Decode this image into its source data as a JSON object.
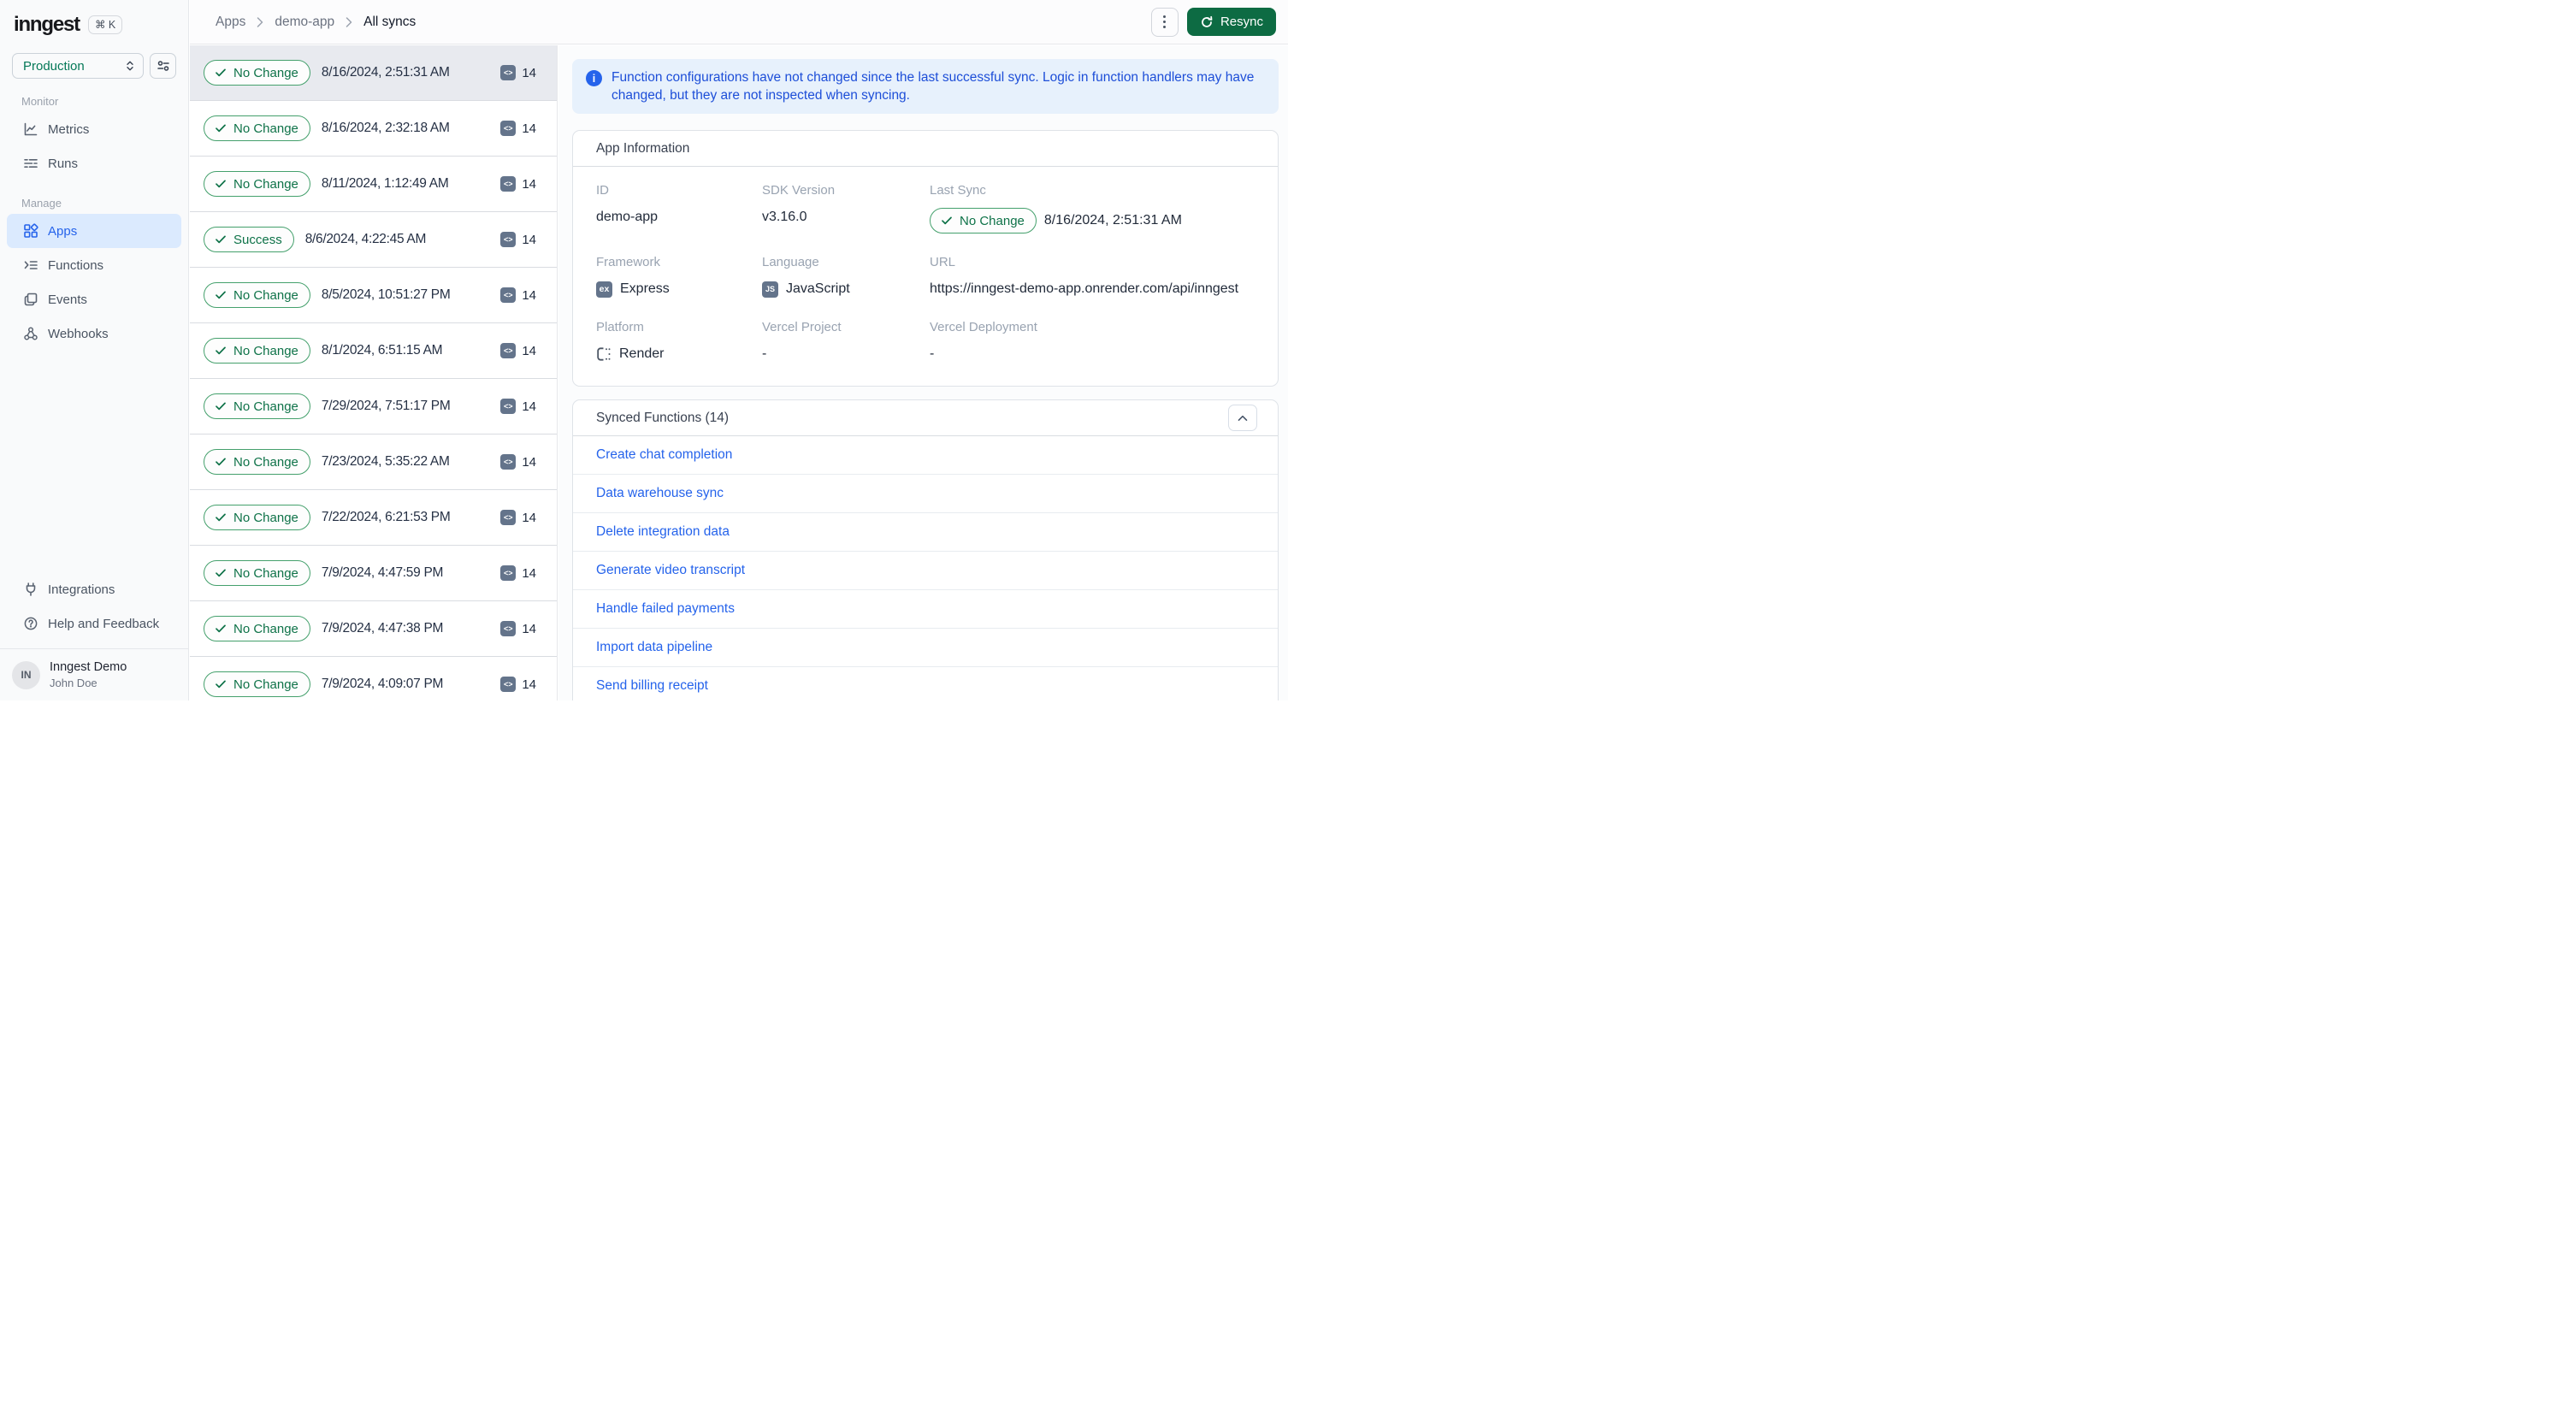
{
  "sidebar": {
    "logo": "inngest",
    "search_shortcut": "⌘ K",
    "environment": "Production",
    "sections": [
      {
        "label": "Monitor",
        "items": [
          "Metrics",
          "Runs"
        ]
      },
      {
        "label": "Manage",
        "items": [
          "Apps",
          "Functions",
          "Events",
          "Webhooks"
        ]
      }
    ],
    "footer_items": [
      "Integrations",
      "Help and Feedback"
    ],
    "profile": {
      "initials": "IN",
      "org": "Inngest Demo",
      "user": "John Doe"
    }
  },
  "header": {
    "breadcrumb": [
      "Apps",
      "demo-app",
      "All syncs"
    ],
    "resync": "Resync"
  },
  "sync_list": [
    {
      "status": "No Change",
      "timestamp": "8/16/2024, 2:51:31 AM",
      "count": 14,
      "selected": true
    },
    {
      "status": "No Change",
      "timestamp": "8/16/2024, 2:32:18 AM",
      "count": 14
    },
    {
      "status": "No Change",
      "timestamp": "8/11/2024, 1:12:49 AM",
      "count": 14
    },
    {
      "status": "Success",
      "timestamp": "8/6/2024, 4:22:45 AM",
      "count": 14
    },
    {
      "status": "No Change",
      "timestamp": "8/5/2024, 10:51:27 PM",
      "count": 14
    },
    {
      "status": "No Change",
      "timestamp": "8/1/2024, 6:51:15 AM",
      "count": 14
    },
    {
      "status": "No Change",
      "timestamp": "7/29/2024, 7:51:17 PM",
      "count": 14
    },
    {
      "status": "No Change",
      "timestamp": "7/23/2024, 5:35:22 AM",
      "count": 14
    },
    {
      "status": "No Change",
      "timestamp": "7/22/2024, 6:21:53 PM",
      "count": 14
    },
    {
      "status": "No Change",
      "timestamp": "7/9/2024, 4:47:59 PM",
      "count": 14
    },
    {
      "status": "No Change",
      "timestamp": "7/9/2024, 4:47:38 PM",
      "count": 14
    },
    {
      "status": "No Change",
      "timestamp": "7/9/2024, 4:09:07 PM",
      "count": 14
    }
  ],
  "detail": {
    "banner": "Function configurations have not changed since the last successful sync. Logic in function handlers may have changed, but they are not inspected when syncing.",
    "app_info": {
      "title": "App Information",
      "id_label": "ID",
      "id": "demo-app",
      "sdk_label": "SDK Version",
      "sdk": "v3.16.0",
      "last_sync_label": "Last Sync",
      "last_sync_status": "No Change",
      "last_sync_time": "8/16/2024, 2:51:31 AM",
      "framework_label": "Framework",
      "framework": "Express",
      "language_label": "Language",
      "language": "JavaScript",
      "url_label": "URL",
      "url": "https://inngest-demo-app.onrender.com/api/inngest",
      "platform_label": "Platform",
      "platform": "Render",
      "vercel_project_label": "Vercel Project",
      "vercel_project": "-",
      "vercel_deployment_label": "Vercel Deployment",
      "vercel_deployment": "-"
    },
    "synced_functions": {
      "title": "Synced Functions (14)",
      "items": [
        "Create chat completion",
        "Data warehouse sync",
        "Delete integration data",
        "Generate video transcript",
        "Handle failed payments",
        "Import data pipeline",
        "Send billing receipt"
      ]
    }
  },
  "icons": {
    "code": "<>",
    "info": "i",
    "framework_chip": "ex",
    "language_chip": "JS"
  },
  "colors": {
    "accent_green": "#0D6B43",
    "badge_green": "#0E7248",
    "link_blue": "#2563EB",
    "banner_blue": "#1D4ED8",
    "active_item_bg": "#DBEAFE",
    "selected_row_bg": "#E8EAEF"
  }
}
